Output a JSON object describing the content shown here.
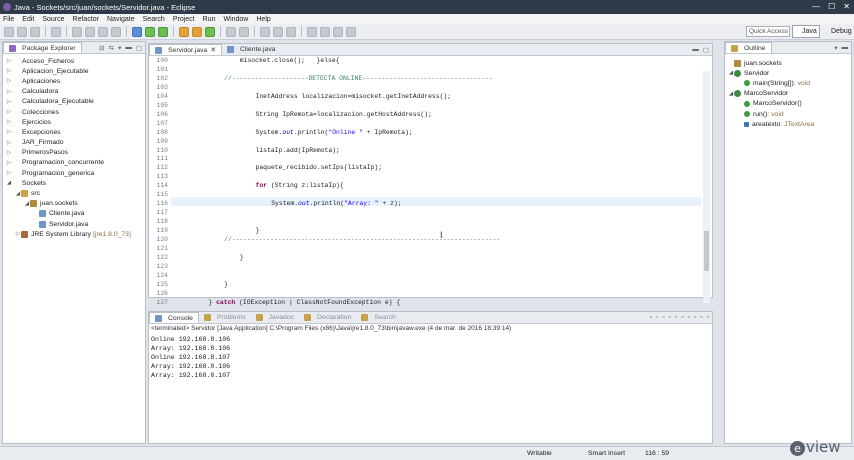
{
  "window": {
    "title": "Java - Sockets/src/juan/sockets/Servidor.java - Eclipse",
    "controls": [
      "—",
      "☐",
      "✕"
    ]
  },
  "menu": [
    "File",
    "Edit",
    "Source",
    "Refactor",
    "Navigate",
    "Search",
    "Project",
    "Run",
    "Window",
    "Help"
  ],
  "toolbar": {
    "quick_access": "Quick Access",
    "perspectives": [
      "Java",
      "Debug"
    ]
  },
  "package_explorer": {
    "title": "Package Explorer",
    "items": [
      {
        "label": "Acceso_Ficheros",
        "level": 0,
        "type": "project"
      },
      {
        "label": "Aplicacion_Ejecutable",
        "level": 0,
        "type": "project"
      },
      {
        "label": "Aplicaciones",
        "level": 0,
        "type": "project"
      },
      {
        "label": "Calculadora",
        "level": 0,
        "type": "project"
      },
      {
        "label": "Calculadora_Ejecutable",
        "level": 0,
        "type": "project"
      },
      {
        "label": "Colecciones",
        "level": 0,
        "type": "project"
      },
      {
        "label": "Ejercicios",
        "level": 0,
        "type": "project"
      },
      {
        "label": "Excepciones",
        "level": 0,
        "type": "project"
      },
      {
        "label": "JAR_Firmado",
        "level": 0,
        "type": "project"
      },
      {
        "label": "PrimerosPasos",
        "level": 0,
        "type": "project"
      },
      {
        "label": "Programacion_concurrente",
        "level": 0,
        "type": "project"
      },
      {
        "label": "Programacion_generica",
        "level": 0,
        "type": "project"
      },
      {
        "label": "Sockets",
        "level": 0,
        "type": "project",
        "expanded": true
      },
      {
        "label": "src",
        "level": 1,
        "type": "src",
        "expanded": true
      },
      {
        "label": "juan.sockets",
        "level": 2,
        "type": "pkg",
        "expanded": true
      },
      {
        "label": "Cliente.java",
        "level": 3,
        "type": "file"
      },
      {
        "label": "Servidor.java",
        "level": 3,
        "type": "file"
      },
      {
        "label": "JRE System Library",
        "suffix": "[jre1.8.0_73]",
        "level": 1,
        "type": "lib"
      }
    ]
  },
  "editor": {
    "tabs": [
      {
        "label": "Servidor.java",
        "active": true
      },
      {
        "label": "Cliente.java",
        "active": false
      }
    ],
    "lines": [
      {
        "n": "100",
        "indent": 8,
        "parts": [
          [
            "",
            "misocket.close();   }else{"
          ]
        ]
      },
      {
        "n": "101",
        "indent": 0,
        "parts": [
          [
            "",
            ""
          ]
        ]
      },
      {
        "n": "102",
        "indent": 6,
        "parts": [
          [
            "cm",
            "//--------------------DETECTA ONLINE----------------------------------"
          ]
        ]
      },
      {
        "n": "103",
        "indent": 0,
        "parts": [
          [
            "",
            ""
          ]
        ]
      },
      {
        "n": "104",
        "indent": 10,
        "parts": [
          [
            "",
            "InetAddress localizacion=misocket.getInetAddress();"
          ]
        ]
      },
      {
        "n": "105",
        "indent": 0,
        "parts": [
          [
            "",
            ""
          ]
        ]
      },
      {
        "n": "106",
        "indent": 10,
        "parts": [
          [
            "",
            "String IpRemota=localizacion.getHostAddress();"
          ]
        ]
      },
      {
        "n": "107",
        "indent": 0,
        "parts": [
          [
            "",
            ""
          ]
        ]
      },
      {
        "n": "108",
        "indent": 10,
        "parts": [
          [
            "",
            "System."
          ],
          [
            "fldc",
            "out"
          ],
          [
            "",
            ".println("
          ],
          [
            "str",
            "\"Online \""
          ],
          [
            "",
            " + IpRemota);"
          ]
        ]
      },
      {
        "n": "109",
        "indent": 0,
        "parts": [
          [
            "",
            ""
          ]
        ]
      },
      {
        "n": "110",
        "indent": 10,
        "parts": [
          [
            "",
            "listaIp.add(IpRemota);"
          ]
        ]
      },
      {
        "n": "111",
        "indent": 0,
        "parts": [
          [
            "",
            ""
          ]
        ]
      },
      {
        "n": "112",
        "indent": 10,
        "parts": [
          [
            "",
            "paquete_recibido.setIps(listaIp);"
          ]
        ]
      },
      {
        "n": "113",
        "indent": 0,
        "parts": [
          [
            "",
            ""
          ]
        ]
      },
      {
        "n": "114",
        "indent": 10,
        "parts": [
          [
            "kw",
            "for"
          ],
          [
            "",
            " (String z:listaIp){"
          ]
        ]
      },
      {
        "n": "115",
        "indent": 0,
        "parts": [
          [
            "",
            ""
          ]
        ]
      },
      {
        "n": "116",
        "indent": 12,
        "parts": [
          [
            "",
            "System."
          ],
          [
            "fldc",
            "out"
          ],
          [
            "",
            ".println("
          ],
          [
            "str",
            "\"Array: \""
          ],
          [
            "",
            " + z);"
          ]
        ]
      },
      {
        "n": "117",
        "indent": 0,
        "parts": [
          [
            "",
            ""
          ]
        ]
      },
      {
        "n": "118",
        "indent": 0,
        "parts": [
          [
            "",
            ""
          ]
        ]
      },
      {
        "n": "119",
        "indent": 10,
        "parts": [
          [
            "",
            "}"
          ]
        ]
      },
      {
        "n": "120",
        "indent": 6,
        "parts": [
          [
            "cm",
            "//----------------------------------------------------------------------"
          ]
        ]
      },
      {
        "n": "121",
        "indent": 0,
        "parts": [
          [
            "",
            ""
          ]
        ]
      },
      {
        "n": "122",
        "indent": 8,
        "parts": [
          [
            "",
            "}"
          ]
        ]
      },
      {
        "n": "123",
        "indent": 0,
        "parts": [
          [
            "",
            ""
          ]
        ]
      },
      {
        "n": "124",
        "indent": 0,
        "parts": [
          [
            "",
            ""
          ]
        ]
      },
      {
        "n": "125",
        "indent": 6,
        "parts": [
          [
            "",
            "}"
          ]
        ]
      },
      {
        "n": "126",
        "indent": 0,
        "parts": [
          [
            "",
            ""
          ]
        ]
      },
      {
        "n": "127",
        "indent": 4,
        "parts": [
          [
            "",
            "} "
          ],
          [
            "kw",
            "catch"
          ],
          [
            "",
            " (IOException | ClassNotFoundException e) {"
          ]
        ]
      }
    ]
  },
  "console": {
    "tabs": [
      {
        "label": "Console",
        "active": true
      },
      {
        "label": "Problems",
        "active": false
      },
      {
        "label": "Javadoc",
        "active": false
      },
      {
        "label": "Declaration",
        "active": false
      },
      {
        "label": "Search",
        "active": false
      }
    ],
    "terminated": "<terminated> Servidor [Java Application] C:\\Program Files (x86)\\Java\\jre1.8.0_73\\bin\\javaw.exe (4 de mar. de 2016 18:39:14)",
    "output": [
      "Online 192.168.8.106",
      "Array: 192.168.8.106",
      "Online 192.168.8.107",
      "Array: 192.168.8.106",
      "Array: 192.168.8.107"
    ]
  },
  "outline": {
    "title": "Outline",
    "items": [
      {
        "label": "juan.sockets",
        "level": 0,
        "type": "pkg"
      },
      {
        "label": "Servidor",
        "level": 0,
        "type": "cls",
        "expanded": true
      },
      {
        "label": "main(String[])",
        "type_suffix": " : void",
        "level": 1,
        "type": "meth"
      },
      {
        "label": "MarcoServidor",
        "level": 0,
        "type": "cls",
        "expanded": true
      },
      {
        "label": "MarcoServidor()",
        "level": 1,
        "type": "meth"
      },
      {
        "label": "run()",
        "type_suffix": " : void",
        "level": 1,
        "type": "meth"
      },
      {
        "label": "areatexto",
        "type_suffix": " : JTextArea",
        "level": 1,
        "type": "fld"
      }
    ]
  },
  "status": {
    "mode": "Writable",
    "insert": "Smart Insert",
    "position": "116 : 59"
  },
  "watermark": {
    "glyph": "e",
    "text": "view"
  }
}
